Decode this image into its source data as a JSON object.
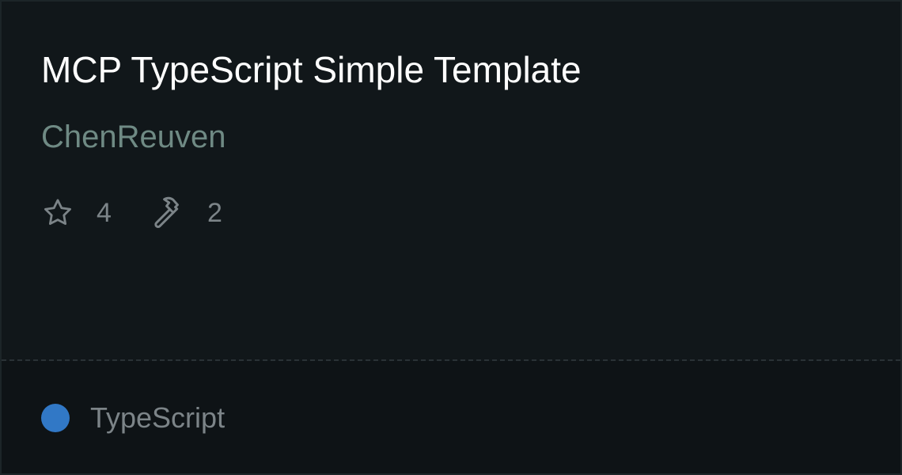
{
  "repo": {
    "title": "MCP TypeScript Simple Template",
    "owner": "ChenReuven"
  },
  "stats": {
    "stars_icon": "star-icon",
    "stars": "4",
    "tools_icon": "hammer-icon",
    "tools": "2"
  },
  "language": {
    "name": "TypeScript",
    "color": "#3178c6"
  }
}
